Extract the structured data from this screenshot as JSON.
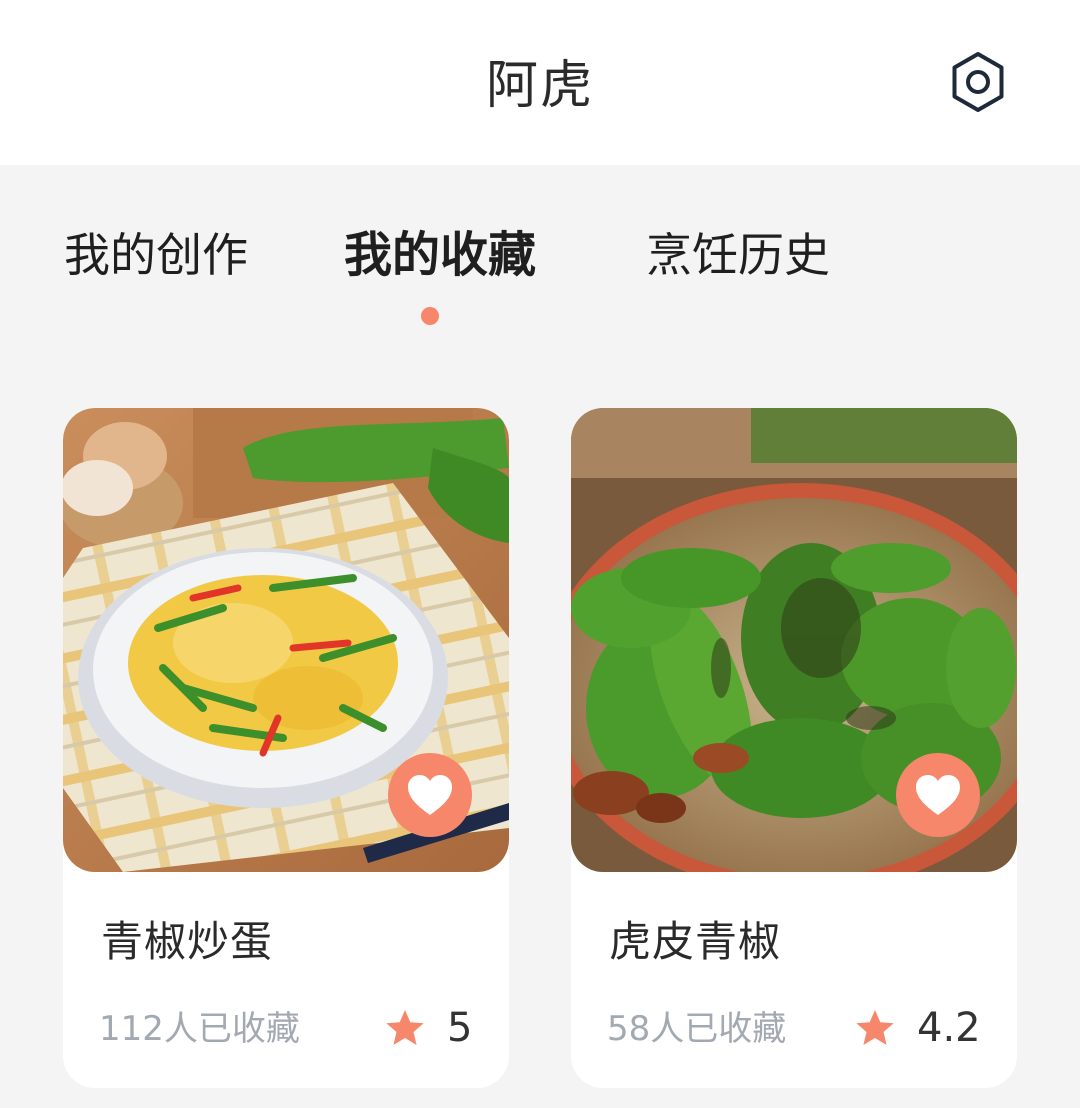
{
  "header": {
    "title": "阿虎",
    "settings_icon": "gear-icon"
  },
  "tabs": [
    {
      "label": "我的创作",
      "active": false
    },
    {
      "label": "我的收藏",
      "active": true
    },
    {
      "label": "烹饪历史",
      "active": false
    }
  ],
  "colors": {
    "accent": "#f6876a",
    "background": "#f4f4f4",
    "text_muted": "#a3a9b3"
  },
  "cards": [
    {
      "title": "青椒炒蛋",
      "favorites_text": "112人已收藏",
      "rating": "5",
      "image": "scrambled-eggs-with-green-pepper-photo",
      "favorited": true
    },
    {
      "title": "虎皮青椒",
      "favorites_text": "58人已收藏",
      "rating": "4.2",
      "image": "tiger-skin-peppers-photo",
      "favorited": true
    }
  ]
}
